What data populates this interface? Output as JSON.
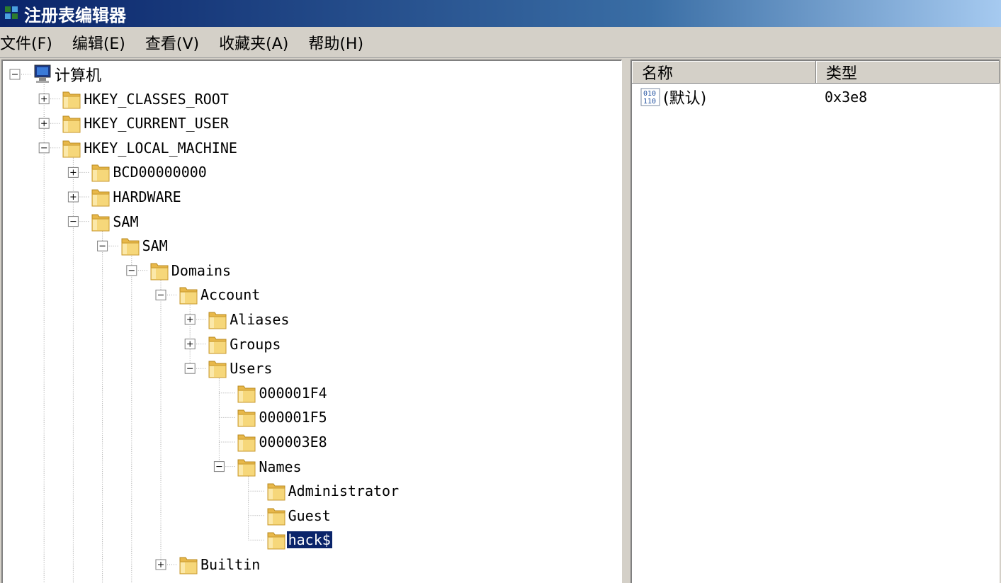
{
  "window": {
    "title": "注册表编辑器"
  },
  "menu": [
    {
      "label": "文件(F)"
    },
    {
      "label": "编辑(E)"
    },
    {
      "label": "查看(V)"
    },
    {
      "label": "收藏夹(A)"
    },
    {
      "label": "帮助(H)"
    }
  ],
  "tree": [
    {
      "label": "计算机",
      "level": 0,
      "toggle": "minus",
      "icon": "computer-icon"
    },
    {
      "label": "HKEY_CLASSES_ROOT",
      "level": 1,
      "toggle": "plus",
      "icon": "folder-icon"
    },
    {
      "label": "HKEY_CURRENT_USER",
      "level": 1,
      "toggle": "plus",
      "icon": "folder-icon"
    },
    {
      "label": "HKEY_LOCAL_MACHINE",
      "level": 1,
      "toggle": "minus",
      "icon": "folder-icon"
    },
    {
      "label": "BCD00000000",
      "level": 2,
      "toggle": "plus",
      "icon": "folder-icon"
    },
    {
      "label": "HARDWARE",
      "level": 2,
      "toggle": "plus",
      "icon": "folder-icon"
    },
    {
      "label": "SAM",
      "level": 2,
      "toggle": "minus",
      "icon": "folder-icon"
    },
    {
      "label": "SAM",
      "level": 3,
      "toggle": "minus",
      "icon": "folder-icon"
    },
    {
      "label": "Domains",
      "level": 4,
      "toggle": "minus",
      "icon": "folder-icon"
    },
    {
      "label": "Account",
      "level": 5,
      "toggle": "minus",
      "icon": "folder-icon"
    },
    {
      "label": "Aliases",
      "level": 6,
      "toggle": "plus",
      "icon": "folder-icon"
    },
    {
      "label": "Groups",
      "level": 6,
      "toggle": "plus",
      "icon": "folder-icon"
    },
    {
      "label": "Users",
      "level": 6,
      "toggle": "minus",
      "icon": "folder-icon"
    },
    {
      "label": "000001F4",
      "level": 7,
      "toggle": "none",
      "icon": "folder-icon"
    },
    {
      "label": "000001F5",
      "level": 7,
      "toggle": "none",
      "icon": "folder-icon"
    },
    {
      "label": "000003E8",
      "level": 7,
      "toggle": "none",
      "icon": "folder-icon"
    },
    {
      "label": "Names",
      "level": 7,
      "toggle": "minus",
      "icon": "folder-icon"
    },
    {
      "label": "Administrator",
      "level": 8,
      "toggle": "none",
      "icon": "folder-icon"
    },
    {
      "label": "Guest",
      "level": 8,
      "toggle": "none",
      "icon": "folder-icon"
    },
    {
      "label": "hack$",
      "level": 8,
      "toggle": "none",
      "icon": "folder-icon",
      "selected": true
    },
    {
      "label": "Builtin",
      "level": 5,
      "toggle": "plus",
      "icon": "folder-icon"
    }
  ],
  "values_list": {
    "columns": {
      "name": "名称",
      "type": "类型"
    },
    "rows": [
      {
        "name": "(默认)",
        "type": "0x3e8",
        "icon": "binary-value-icon"
      }
    ]
  }
}
